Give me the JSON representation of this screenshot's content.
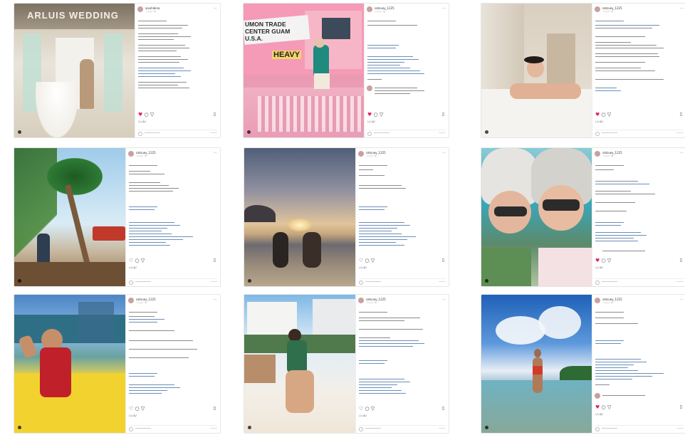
{
  "page": {
    "title": ""
  },
  "colors": {
    "accent": "#6b8fb8",
    "like": "#e0245e"
  },
  "posts": [
    {
      "username": "aisuhibina",
      "action": "フォロー中",
      "sign": "ARLUIS WEDDING",
      "liked_by": "いいね！",
      "icons": [
        "heart-icon",
        "comment-icon",
        "share-icon",
        "save-icon"
      ]
    },
    {
      "username": "satsuey_1225",
      "action": "フォロー中",
      "sign": "UMON TRADE CENTER GUAM U.S.A.",
      "sign2": "HEAVY",
      "liked_by": "いいね！",
      "icons": [
        "heart-icon",
        "comment-icon",
        "share-icon",
        "save-icon"
      ]
    },
    {
      "username": "satsuey_1225",
      "action": "フォロー中",
      "liked_by": "いいね！",
      "icons": [
        "heart-icon",
        "comment-icon",
        "share-icon",
        "save-icon"
      ]
    },
    {
      "username": "satsuey_1225",
      "action": "フォロー中",
      "liked_by": "いいね！",
      "icons": [
        "heart-icon",
        "comment-icon",
        "share-icon",
        "save-icon"
      ]
    },
    {
      "username": "satsuey_1225",
      "action": "フォロー中",
      "liked_by": "いいね！",
      "icons": [
        "heart-icon",
        "comment-icon",
        "share-icon",
        "save-icon"
      ]
    },
    {
      "username": "satsuey_1225",
      "action": "フォロー中",
      "liked_by": "いいね！",
      "icons": [
        "heart-icon",
        "comment-icon",
        "share-icon",
        "save-icon"
      ]
    },
    {
      "username": "satsuey_1225",
      "action": "フォロー中",
      "liked_by": "いいね！",
      "icons": [
        "heart-icon",
        "comment-icon",
        "share-icon",
        "save-icon"
      ]
    },
    {
      "username": "satsuey_1225",
      "action": "フォロー中",
      "liked_by": "いいね！",
      "icons": [
        "heart-icon",
        "comment-icon",
        "share-icon",
        "save-icon"
      ]
    },
    {
      "username": "satsuey_1225",
      "action": "フォロー中",
      "liked_by": "いいね！",
      "icons": [
        "heart-icon",
        "comment-icon",
        "share-icon",
        "save-icon"
      ]
    }
  ]
}
